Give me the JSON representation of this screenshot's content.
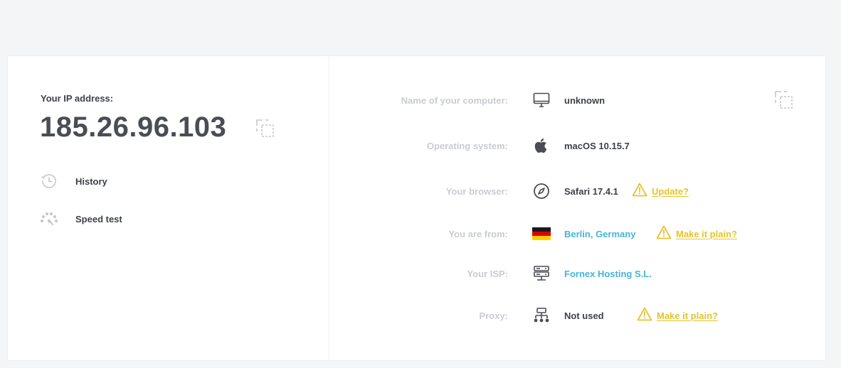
{
  "ip_panel": {
    "label": "Your IP address:",
    "ip": "185.26.96.103",
    "copy_icon": "copy-icon"
  },
  "nav": [
    {
      "label": "History",
      "icon": "history-icon"
    },
    {
      "label": "Speed test",
      "icon": "speedometer-icon"
    }
  ],
  "details": {
    "computer": {
      "label": "Name of your computer:",
      "value": "unknown",
      "icon": "monitor-icon"
    },
    "os": {
      "label": "Operating system:",
      "value": "macOS 10.15.7",
      "icon": "apple-icon"
    },
    "browser": {
      "label": "Your browser:",
      "value": "Safari 17.4.1",
      "icon": "compass-icon",
      "warning": "Update?"
    },
    "location": {
      "label": "You are from:",
      "value": "Berlin, Germany",
      "icon": "germany-flag-icon",
      "warning": "Make it plain?"
    },
    "isp": {
      "label": "Your ISP:",
      "value": "Fornex Hosting S.L.",
      "icon": "server-icon"
    },
    "proxy": {
      "label": "Proxy:",
      "value": "Not used",
      "icon": "network-icon",
      "warning": "Make it plain?"
    }
  },
  "colors": {
    "link": "#45b5d8",
    "warning": "#e4c42b",
    "label_muted": "#c9ccd1",
    "text_dark": "#3d4148"
  }
}
